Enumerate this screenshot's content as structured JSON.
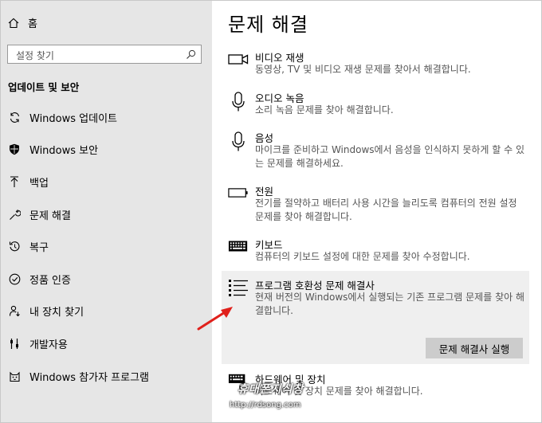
{
  "sidebar": {
    "home_label": "홈",
    "search_placeholder": "설정 찾기",
    "section_title": "업데이트 및 보안",
    "items": [
      {
        "label": "Windows 업데이트"
      },
      {
        "label": "Windows 보안"
      },
      {
        "label": "백업"
      },
      {
        "label": "문제 해결"
      },
      {
        "label": "복구"
      },
      {
        "label": "정품 인증"
      },
      {
        "label": "내 장치 찾기"
      },
      {
        "label": "개발자용"
      },
      {
        "label": "Windows 참가자 프로그램"
      }
    ]
  },
  "main": {
    "title": "문제 해결",
    "items": [
      {
        "title": "비디오 재생",
        "desc": "동영상, TV 및 비디오 재생 문제를 찾아서 해결합니다."
      },
      {
        "title": "오디오 녹음",
        "desc": "소리 녹음 문제를 찾아 해결합니다."
      },
      {
        "title": "음성",
        "desc": "마이크를 준비하고 Windows에서 음성을 인식하지 못하게 할 수 있는 문제를 해결하세요."
      },
      {
        "title": "전원",
        "desc": "전기를 절약하고 배터리 사용 시간을 늘리도록 컴퓨터의 전원 설정 문제를 찾아 해결합니다."
      },
      {
        "title": "키보드",
        "desc": "컴퓨터의 키보드 설정에 대한 문제를 찾아 수정합니다."
      },
      {
        "title": "프로그램 호환성 문제 해결사",
        "desc": "현재 버전의 Windows에서 실행되는 기존 프로그램 문제를 찾아 해결합니다."
      },
      {
        "title": "하드웨어 및 장치",
        "desc": "하드웨어 및 장치 문제를 찾아 해결합니다."
      }
    ],
    "run_button": "문제 해결사 실행"
  },
  "watermark": {
    "text": "휴대폰지식창",
    "url": "http://rdsong.com"
  },
  "colors": {
    "sidebar_bg": "#e6e6e6",
    "selected_bg": "#efefef",
    "button_bg": "#cccccc",
    "arrow": "#e0201b"
  }
}
